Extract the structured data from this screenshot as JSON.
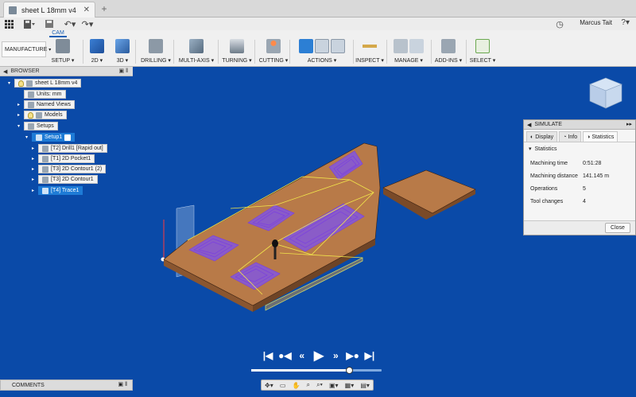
{
  "tab": {
    "title": "sheet L 18mm v4"
  },
  "user": {
    "name": "Marcus Tait"
  },
  "ribbon": {
    "active_tab": "CAM",
    "workspace": "MANUFACTURE",
    "groups": [
      {
        "label": "SETUP ▾"
      },
      {
        "label": "2D ▾"
      },
      {
        "label": "3D ▾"
      },
      {
        "label": "DRILLING ▾"
      },
      {
        "label": "MULTI-AXIS ▾"
      },
      {
        "label": "TURNING ▾"
      },
      {
        "label": "CUTTING ▾"
      },
      {
        "label": "ACTIONS ▾"
      },
      {
        "label": "INSPECT ▾"
      },
      {
        "label": "MANAGE ▾"
      },
      {
        "label": "ADD-INS ▾"
      },
      {
        "label": "SELECT ▾"
      }
    ]
  },
  "browser": {
    "title": "BROWSER",
    "items": [
      {
        "label": "sheet L 18mm v4"
      },
      {
        "label": "Units: mm"
      },
      {
        "label": "Named Views"
      },
      {
        "label": "Models"
      },
      {
        "label": "Setups"
      },
      {
        "label": "Setup1"
      },
      {
        "label": "[T2] Drill1 [Rapid out]"
      },
      {
        "label": "[T1] 2D Pocket1"
      },
      {
        "label": "[T3] 2D Contour1 (2)"
      },
      {
        "label": "[T3] 2D Contour1"
      },
      {
        "label": "[T4] Trace1"
      }
    ]
  },
  "simulate": {
    "title": "SIMULATE",
    "tabs": [
      "Display",
      "Info",
      "Statistics"
    ],
    "section": "Statistics",
    "stats": [
      {
        "label": "Machining time",
        "value": "0:51:28"
      },
      {
        "label": "Machining distance",
        "value": "141.145 m"
      },
      {
        "label": "Operations",
        "value": "5"
      },
      {
        "label": "Tool changes",
        "value": "4"
      }
    ],
    "close_label": "Close"
  },
  "comments": {
    "title": "COMMENTS"
  },
  "playback": {
    "position_fraction": 0.75
  },
  "colors": {
    "viewport": "#0a4aa8",
    "stock": "#b87a48",
    "toolpath": "#7a3fe0",
    "rapid": "#f2e64a"
  }
}
